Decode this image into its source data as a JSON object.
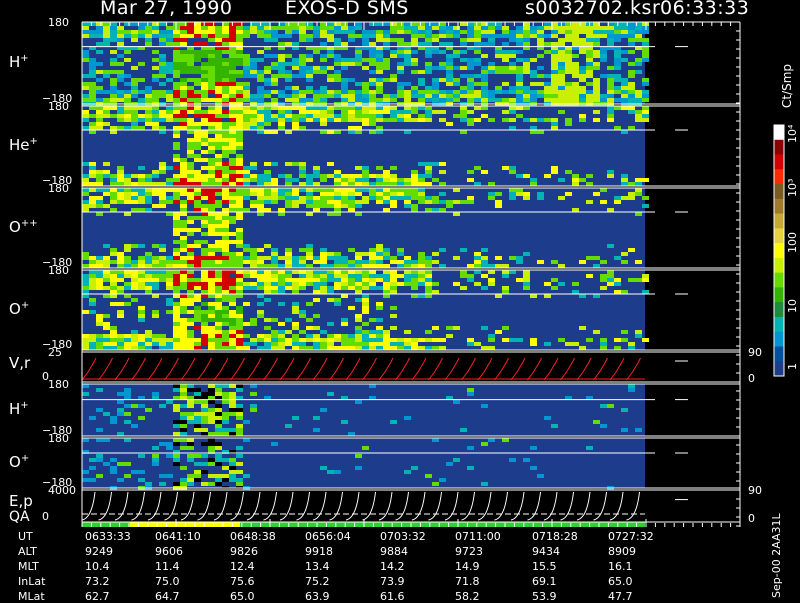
{
  "header": {
    "date": "Mar 27, 1990",
    "mission": "EXOS-D SMS",
    "file": "s0032702.ksr",
    "time": "06:33:33"
  },
  "panels": [
    {
      "label": "H",
      "sup": "+",
      "top_tick": "180",
      "bottom_tick": "−180"
    },
    {
      "label": "He",
      "sup": "+",
      "top_tick": "180",
      "bottom_tick": "−180"
    },
    {
      "label": "O",
      "sup": "++",
      "top_tick": "180",
      "bottom_tick": "−180"
    },
    {
      "label": "O",
      "sup": "+",
      "top_tick": "180",
      "bottom_tick": "−180"
    },
    {
      "label": "V,r",
      "sup": "",
      "top_tick": "25",
      "bottom_tick": "0",
      "right_top": "90",
      "right_bottom": "0"
    },
    {
      "label": "H",
      "sup": "+",
      "top_tick": "180",
      "bottom_tick": "−180"
    },
    {
      "label": "O",
      "sup": "+",
      "top_tick": "180",
      "bottom_tick": "−180"
    },
    {
      "label": "E,p",
      "sup": "",
      "top_tick": "4000",
      "bottom_tick": "0",
      "right_top": "90",
      "right_bottom": "0"
    }
  ],
  "qa_label": "QA",
  "colorbar": {
    "unit": "Ct/Smp",
    "ticks": [
      "10⁴",
      "10³",
      "100",
      "10",
      "1"
    ],
    "colors": [
      "#ffffff",
      "#8b0000",
      "#d40000",
      "#ff2a00",
      "#7a5c1e",
      "#a07a2a",
      "#c8a832",
      "#e6d23c",
      "#ffff00",
      "#c8f000",
      "#64dc00",
      "#32b400",
      "#1e8c3c",
      "#00b4b4",
      "#0096d2",
      "#0050a0",
      "#1e3c8c"
    ]
  },
  "side_note": "Sep-00  2AA31L",
  "footer": {
    "rows": [
      {
        "name": "UT",
        "values": [
          "0633:33",
          "0641:10",
          "0648:38",
          "0656:04",
          "0703:32",
          "0711:00",
          "0718:28",
          "0727:32"
        ]
      },
      {
        "name": "ALT",
        "values": [
          "9249",
          "9606",
          "9826",
          "9918",
          "9884",
          "9723",
          "9434",
          "8909"
        ]
      },
      {
        "name": "MLT",
        "values": [
          "10.4",
          "11.4",
          "12.4",
          "13.4",
          "14.2",
          "14.9",
          "15.5",
          "16.1"
        ]
      },
      {
        "name": "InLat",
        "values": [
          "73.2",
          "75.0",
          "75.6",
          "75.2",
          "73.9",
          "71.8",
          "69.1",
          "65.0"
        ]
      },
      {
        "name": "MLat",
        "values": [
          "62.7",
          "64.7",
          "65.0",
          "63.9",
          "61.6",
          "58.2",
          "53.9",
          "47.7"
        ]
      }
    ]
  },
  "chart_data": {
    "type": "heatmap",
    "title": "Mar 27, 1990   EXOS-D SMS   s0032702.ksr  06:33:33",
    "x_ticks": [
      "0633:33",
      "0641:10",
      "0648:38",
      "0656:04",
      "0703:32",
      "0711:00",
      "0718:28",
      "0727:32"
    ],
    "panels": [
      "H+",
      "He+",
      "O++",
      "O+",
      "V,r",
      "H+",
      "O+",
      "E,p"
    ],
    "pitch_angle_range": [
      -180,
      180
    ],
    "vr_range": [
      0,
      25
    ],
    "ep_range": [
      0,
      4000
    ],
    "colorbar_range": [
      "1",
      "10⁴"
    ],
    "colorbar_unit": "Ct/Smp",
    "colorscale_colors": [
      "#ffffff",
      "#8b0000",
      "#d40000",
      "#ff2a00",
      "#7a5c1e",
      "#a07a2a",
      "#c8a832",
      "#e6d23c",
      "#ffff00",
      "#c8f000",
      "#64dc00",
      "#32b400",
      "#1e8c3c",
      "#00b4b4",
      "#0096d2",
      "#0050a0",
      "#1e3c8c"
    ],
    "background_color": "#1e3c8c"
  }
}
